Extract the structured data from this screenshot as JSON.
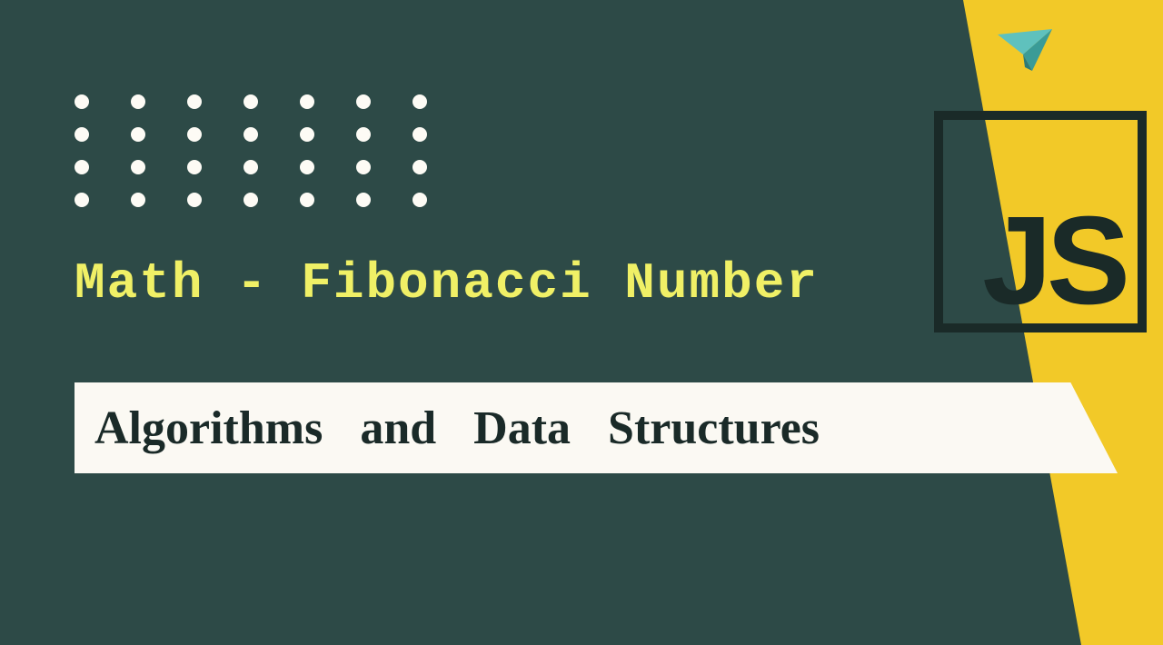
{
  "subtitle": "Math - Fibonacci Number",
  "banner": "Algorithms and Data Structures",
  "logo": {
    "text": "JS"
  },
  "dot_grid": {
    "rows": 4,
    "cols": 7
  },
  "colors": {
    "background": "#2d4a47",
    "accent_yellow": "#f2c928",
    "subtitle_yellow": "#f0f066",
    "banner_bg": "#fbf9f3",
    "logo_dark": "#1a2a28",
    "dot_white": "#fdfbf5",
    "plane_cyan": "#5fc1bd"
  }
}
